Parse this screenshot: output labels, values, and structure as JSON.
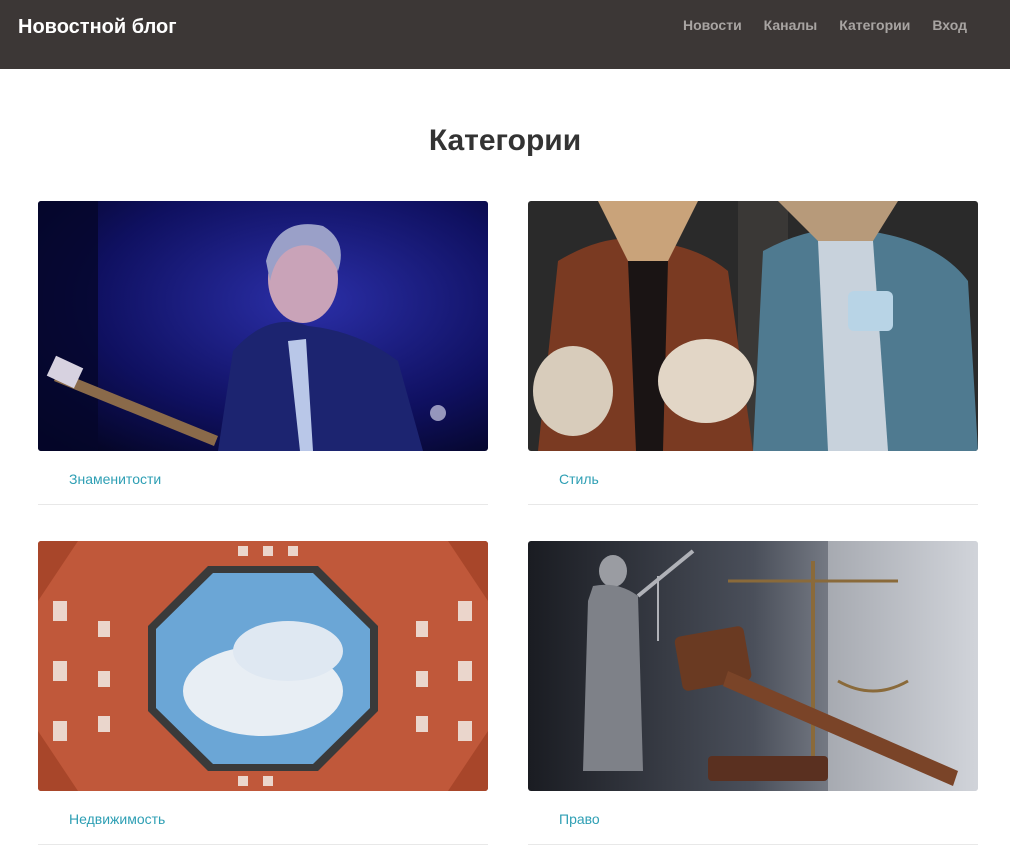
{
  "navbar": {
    "brand": "Новостной блог",
    "links": [
      "Новости",
      "Каналы",
      "Категории",
      "Вход"
    ]
  },
  "page": {
    "title": "Категории"
  },
  "categories": [
    {
      "name": "Знаменитости",
      "image": "celebrity-guitarist-photo"
    },
    {
      "name": "Стиль",
      "image": "fashion-coats-photo"
    },
    {
      "name": "Недвижимость",
      "image": "courtyard-buildings-photo"
    },
    {
      "name": "Право",
      "image": "justice-statue-gavel-photo"
    }
  ],
  "colors": {
    "navbar_bg": "#3c3736",
    "link": "#2e9fb4",
    "nav_link": "#a8a4a2"
  }
}
